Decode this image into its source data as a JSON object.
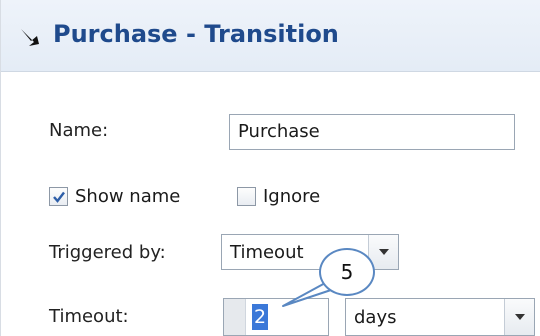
{
  "header": {
    "title": "Purchase - Transition",
    "icon": "transition-arrow-icon"
  },
  "form": {
    "name_label": "Name:",
    "name_value": "Purchase",
    "show_name_label": "Show name",
    "show_name_checked": true,
    "ignore_label": "Ignore",
    "ignore_checked": false,
    "triggered_by_label": "Triggered by:",
    "triggered_by_value": "Timeout",
    "timeout_label": "Timeout:",
    "timeout_value": "2",
    "timeout_unit": "days"
  },
  "callout": {
    "number": "5"
  },
  "colors": {
    "title": "#1f4a8c",
    "selection": "#3b78d8",
    "callout_border": "#5a88c2"
  }
}
